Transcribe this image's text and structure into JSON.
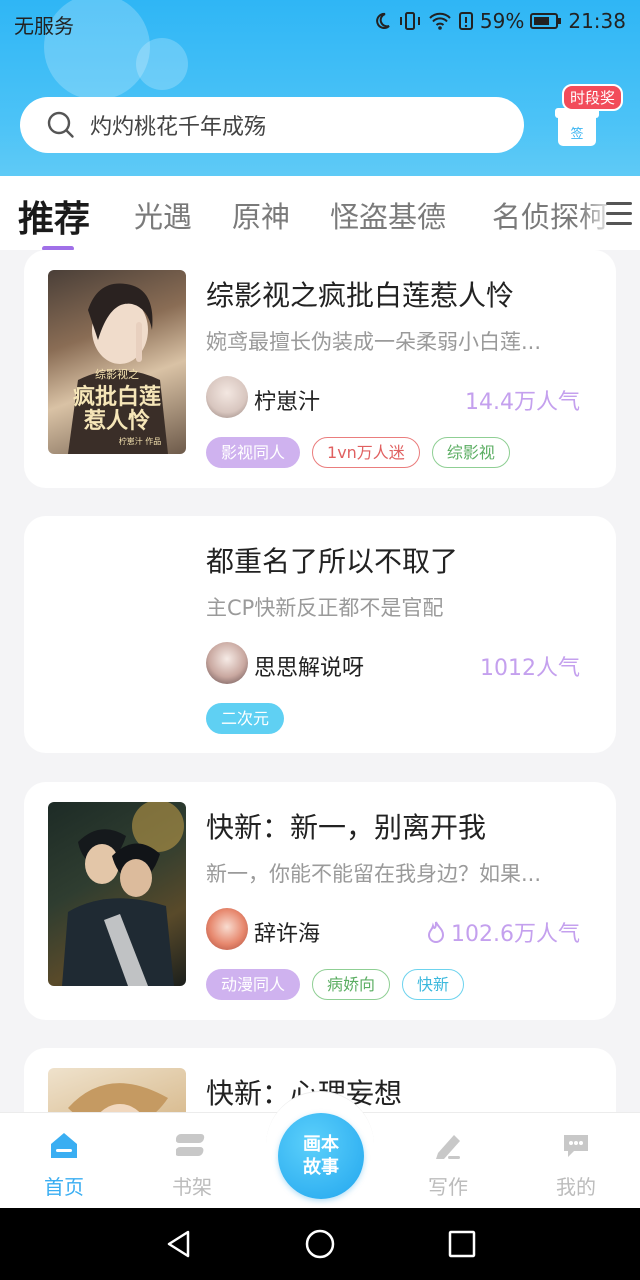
{
  "status_bar": {
    "carrier": "无服务",
    "battery": "59%",
    "time": "21:38"
  },
  "search": {
    "placeholder": "灼灼桃花千年成殇"
  },
  "sign_in": {
    "badge": "时段奖",
    "gift_label": "签"
  },
  "tabs": [
    {
      "label": "推荐",
      "active": true
    },
    {
      "label": "光遇"
    },
    {
      "label": "原神"
    },
    {
      "label": "怪盗基德"
    },
    {
      "label": "名侦探柯"
    }
  ],
  "accent_color": "#a070e8",
  "header_color": "#2fb6f5",
  "feed": [
    {
      "title": "综影视之疯批白莲惹人怜",
      "desc": "婉鸢最擅长伪装成一朵柔弱小白莲...",
      "author": "柠崽汁",
      "popularity": "14.4万人气",
      "hot": false,
      "has_cover": true,
      "cover_text": {
        "top": "综影视之",
        "main1": "疯批白莲",
        "main2": "惹人怜",
        "credit": "柠崽汁 作品"
      },
      "tags": [
        {
          "label": "影视同人",
          "style": "filled-purple"
        },
        {
          "label": "1vn万人迷",
          "style": "outline-red"
        },
        {
          "label": "综影视",
          "style": "outline-green"
        }
      ]
    },
    {
      "title": "都重名了所以不取了",
      "desc": "主CP快新反正都不是官配",
      "author": "思思解说呀",
      "popularity": "1012人气",
      "hot": false,
      "has_cover": false,
      "tags": [
        {
          "label": "二次元",
          "style": "filled-cyan"
        }
      ]
    },
    {
      "title": "快新：新一，别离开我",
      "desc": "新一，你能不能留在我身边？如果...",
      "author": "辞许海",
      "popularity": "102.6万人气",
      "hot": true,
      "has_cover": true,
      "tags": [
        {
          "label": "动漫同人",
          "style": "filled-purple"
        },
        {
          "label": "病娇向",
          "style": "outline-green"
        },
        {
          "label": "快新",
          "style": "outline-cyan"
        }
      ]
    },
    {
      "title": "快新：心理妄想",
      "has_cover": true
    }
  ],
  "bottom_nav": {
    "home": "首页",
    "shelf": "书架",
    "center_line1": "画本",
    "center_line2": "故事",
    "write": "写作",
    "mine": "我的"
  }
}
